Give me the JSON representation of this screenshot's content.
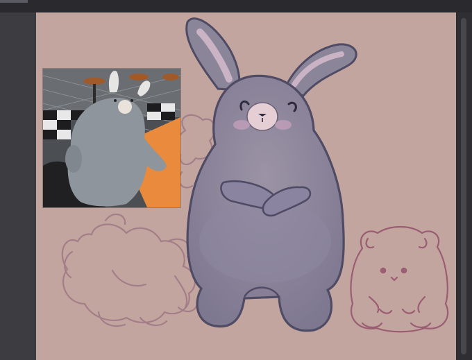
{
  "app": {
    "accent_color": "#c3a59f"
  },
  "canvas": {
    "background_color": "#c3a59f",
    "reference_photo": {
      "subject": "plush-bunny-photo"
    },
    "sketches": [
      {
        "name": "bunny-drawing",
        "color": "#8e8a9c"
      },
      {
        "name": "fluffy-creature-sketch",
        "color": "#a07a86"
      },
      {
        "name": "hamster-sketch",
        "color": "#9a5d72"
      }
    ]
  }
}
